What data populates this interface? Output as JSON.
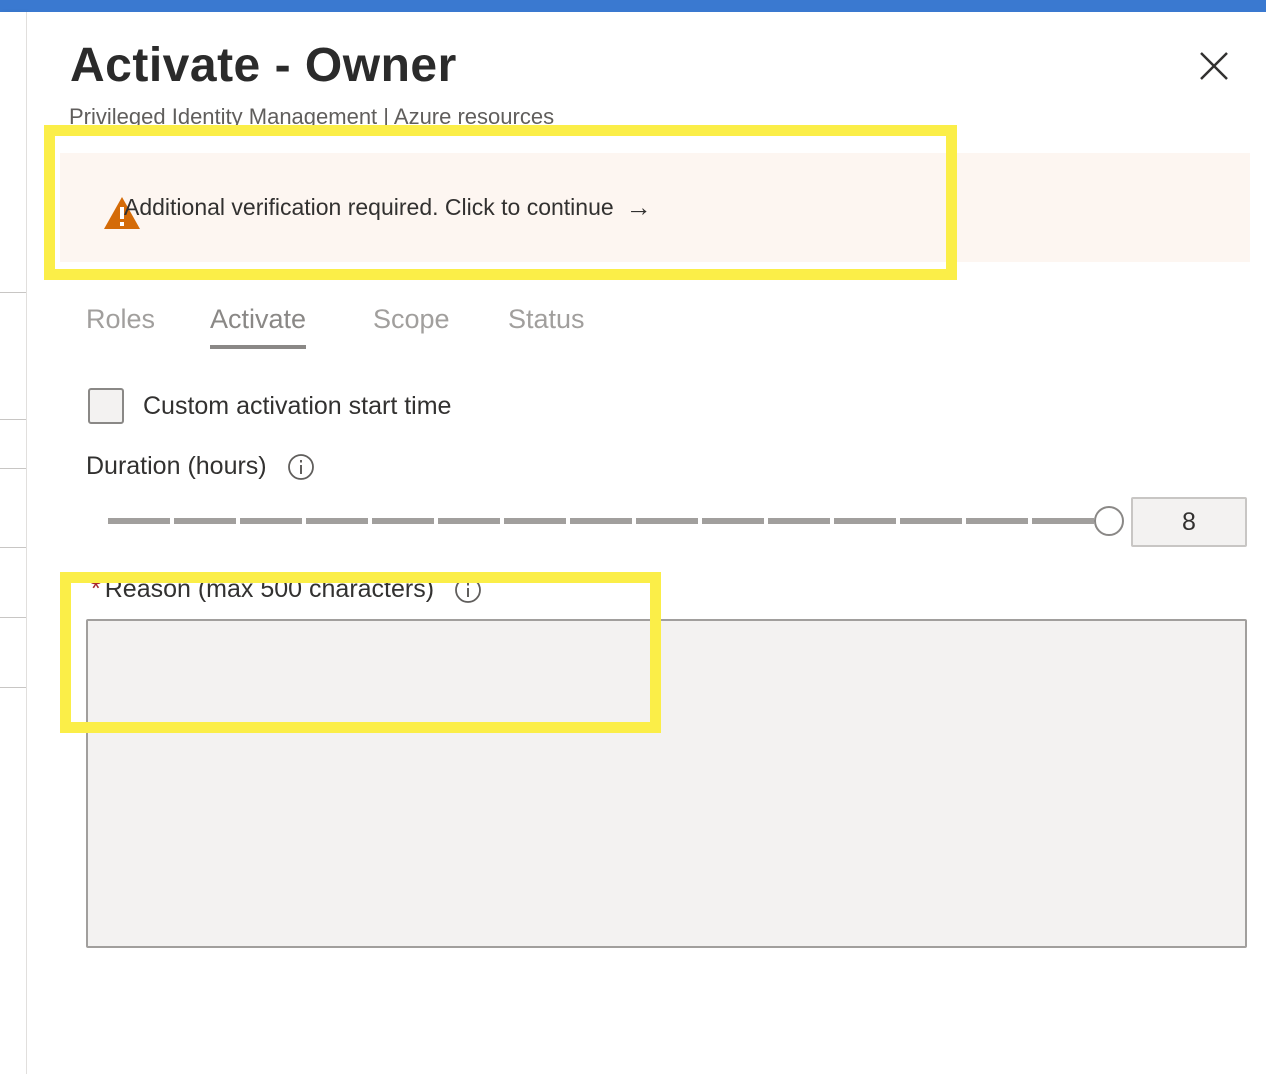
{
  "header": {
    "title": "Activate - Owner",
    "subtitle": "Privileged Identity Management | Azure resources"
  },
  "alert": {
    "message": "Additional verification required. Click to continue",
    "arrow": "→",
    "icon": "warning-icon",
    "icon_color": "#d46b08"
  },
  "tabs": [
    {
      "label": "Roles"
    },
    {
      "label": "Activate",
      "active": true
    },
    {
      "label": "Scope"
    },
    {
      "label": "Status"
    }
  ],
  "form": {
    "custom_start": {
      "label": "Custom activation start time",
      "checked": false
    },
    "duration": {
      "label": "Duration (hours)",
      "value": "8",
      "slider_fraction": 1.0
    },
    "reason": {
      "label": "Reason (max 500 characters)",
      "required_mark": "*",
      "value": ""
    }
  },
  "colors": {
    "top_bar": "#3a79d0",
    "highlight": "#fbee48",
    "alert_background": "#fdf6f1"
  }
}
